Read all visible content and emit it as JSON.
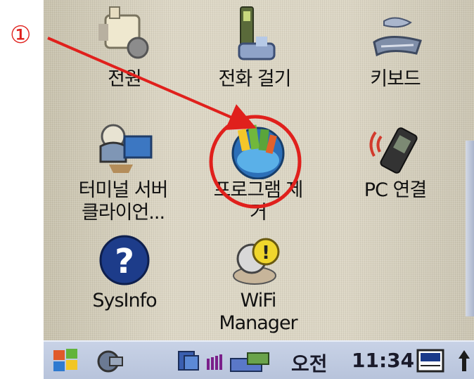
{
  "annotation": {
    "marker": "①",
    "color": "#e0201c"
  },
  "desktop": {
    "icons": [
      {
        "label": "전원",
        "icon": "power-icon"
      },
      {
        "label": "전화 걸기",
        "icon": "phone-dial-icon"
      },
      {
        "label": "키보드",
        "icon": "keyboard-icon"
      },
      {
        "label": "터미널 서버\n클라이언...",
        "icon": "terminal-server-icon"
      },
      {
        "label": "프로그램 제\n거",
        "icon": "remove-programs-icon"
      },
      {
        "label": "PC 연결",
        "icon": "pc-connection-icon"
      },
      {
        "label": "SysInfo",
        "icon": "sysinfo-icon"
      },
      {
        "label": "WiFi\nManager",
        "icon": "wifi-manager-icon"
      }
    ]
  },
  "taskbar": {
    "ampm": "오전",
    "time": "11:34",
    "items": [
      "start-icon",
      "network-sync-icon",
      "signal-icon",
      "battery-icon",
      "input-method-icon"
    ]
  }
}
